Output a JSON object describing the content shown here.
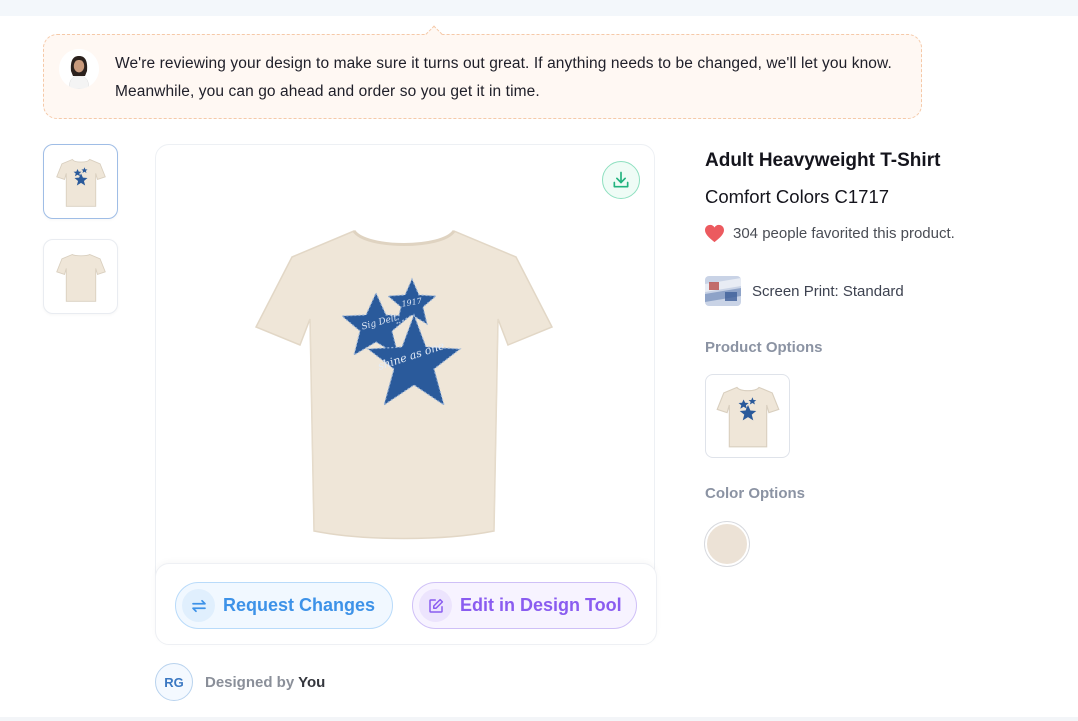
{
  "notice": {
    "message": "We're reviewing your design to make sure it turns out great. If anything needs to be changed, we'll let you know. Meanwhile, you can go ahead and order so you get it in time."
  },
  "thumbnails": [
    {
      "view": "front",
      "active": true
    },
    {
      "view": "back",
      "active": false
    }
  ],
  "design": {
    "star_texts": [
      "Sig Delt",
      "1917",
      "shine as one"
    ],
    "shirt_color": "#efe6d8",
    "star_color": "#2a5a9b"
  },
  "actions": {
    "request_changes": "Request Changes",
    "edit_in_design_tool": "Edit in Design Tool"
  },
  "designer": {
    "initials": "RG",
    "label": "Designed by",
    "name": "You"
  },
  "product": {
    "title": "Adult Heavyweight T-Shirt",
    "model": "Comfort Colors C1717",
    "favorites": "304 people favorited this product.",
    "print_method": "Screen Print: Standard",
    "product_options_label": "Product Options",
    "color_options_label": "Color Options",
    "selected_color": "#ece2d6"
  },
  "icons": {
    "download": "download-icon",
    "request": "swap-arrows-icon",
    "edit": "edit-pencil-icon",
    "heart": "heart-icon"
  }
}
